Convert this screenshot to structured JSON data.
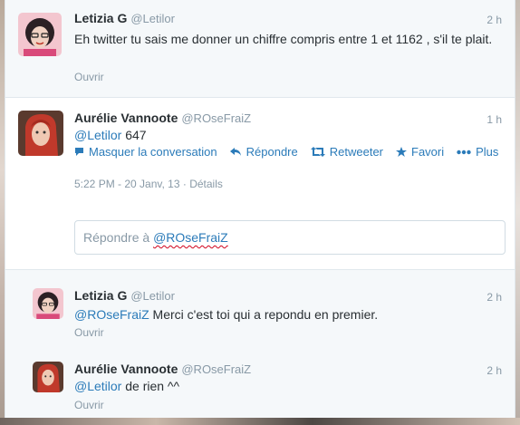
{
  "tweets": [
    {
      "name": "Letizia G",
      "handle": "@Letilor",
      "time": "2 h",
      "text": "Eh twitter tu sais me donner un chiffre compris entre 1 et 1162 , s'il te plait.",
      "open_label": "Ouvrir"
    },
    {
      "name": "Aurélie Vannoote",
      "handle": "@ROseFraiZ",
      "time": "1 h",
      "mention": "@Letilor",
      "text": " 647",
      "actions": {
        "hide": "Masquer la conversation",
        "reply": "Répondre",
        "retweet": "Retweeter",
        "favorite": "Favori",
        "more": "Plus"
      },
      "timestamp": "5:22 PM - 20 Janv, 13",
      "details": "Détails"
    },
    {
      "name": "Letizia G",
      "handle": "@Letilor",
      "time": "2 h",
      "mention": "@ROseFraiZ",
      "text": " Merci c'est toi qui a repondu en premier.",
      "open_label": "Ouvrir"
    },
    {
      "name": "Aurélie Vannoote",
      "handle": "@ROseFraiZ",
      "time": "2 h",
      "mention": "@Letilor",
      "text": " de rien ^^",
      "open_label": "Ouvrir"
    }
  ],
  "reply_box": {
    "prefix": "Répondre à ",
    "mention": "@ROseFraiZ"
  },
  "separator": " · ",
  "colors": {
    "link": "#2b7bb9",
    "muted": "#8899a6"
  }
}
